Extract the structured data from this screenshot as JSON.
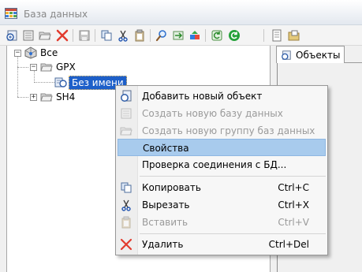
{
  "window": {
    "title": "База данных",
    "title_icon": "database-grid-icon"
  },
  "toolbar": {
    "buttons": [
      {
        "name": "add-object",
        "icon": "add-object-icon"
      },
      {
        "name": "create-database",
        "icon": "create-database-icon"
      },
      {
        "name": "create-group",
        "icon": "open-folder-icon"
      },
      {
        "name": "delete",
        "icon": "red-x-icon"
      },
      {
        "name": "save",
        "icon": "floppy-icon"
      },
      {
        "name": "copy",
        "icon": "copy-icon"
      },
      {
        "name": "cut",
        "icon": "scissors-icon"
      },
      {
        "name": "paste",
        "icon": "clipboard-icon"
      },
      {
        "name": "search",
        "icon": "magnifier-icon"
      },
      {
        "name": "import",
        "icon": "import-icon"
      },
      {
        "name": "export",
        "icon": "export-icon"
      },
      {
        "name": "refresh",
        "icon": "refresh-icon"
      },
      {
        "name": "sync",
        "icon": "green-circle-arrow-icon"
      },
      {
        "name": "document",
        "icon": "document-icon"
      },
      {
        "name": "folder-image",
        "icon": "folder-image-icon"
      }
    ]
  },
  "tree": {
    "root": {
      "label": "Все",
      "expander": "−"
    },
    "nodes": [
      {
        "label": "GPX",
        "expander": "−"
      },
      {
        "label": "Без имени",
        "selected": true
      },
      {
        "label": "SH4",
        "expander": "+"
      }
    ]
  },
  "right_panel": {
    "tab_label": "Объекты"
  },
  "context_menu": {
    "items": [
      {
        "label": "Добавить новый объект",
        "shortcut": "",
        "icon": "add-object-icon",
        "disabled": false
      },
      {
        "label": "Создать новую базу данных",
        "shortcut": "",
        "icon": "create-database-icon",
        "disabled": true
      },
      {
        "label": "Создать новую группу баз данных",
        "shortcut": "",
        "icon": "open-folder-icon",
        "disabled": true
      },
      {
        "label": "Свойства",
        "shortcut": "",
        "icon": "",
        "disabled": false,
        "highlighted": true
      },
      {
        "label": "Проверка соединения с БД...",
        "shortcut": "",
        "icon": "",
        "disabled": false
      },
      {
        "label": "Копировать",
        "shortcut": "Ctrl+C",
        "icon": "copy-icon",
        "disabled": false
      },
      {
        "label": "Вырезать",
        "shortcut": "Ctrl+X",
        "icon": "scissors-icon",
        "disabled": false
      },
      {
        "label": "Вставить",
        "shortcut": "Ctrl+V",
        "icon": "clipboard-icon",
        "disabled": true
      },
      {
        "label": "Удалить",
        "shortcut": "Ctrl+Del",
        "icon": "red-x-icon",
        "disabled": false
      }
    ]
  },
  "colors": {
    "selection": "#1d5fc9",
    "menu_highlight": "#a8cbed",
    "disabled_text": "#9a9a9a",
    "delete_red": "#e23b2e"
  }
}
